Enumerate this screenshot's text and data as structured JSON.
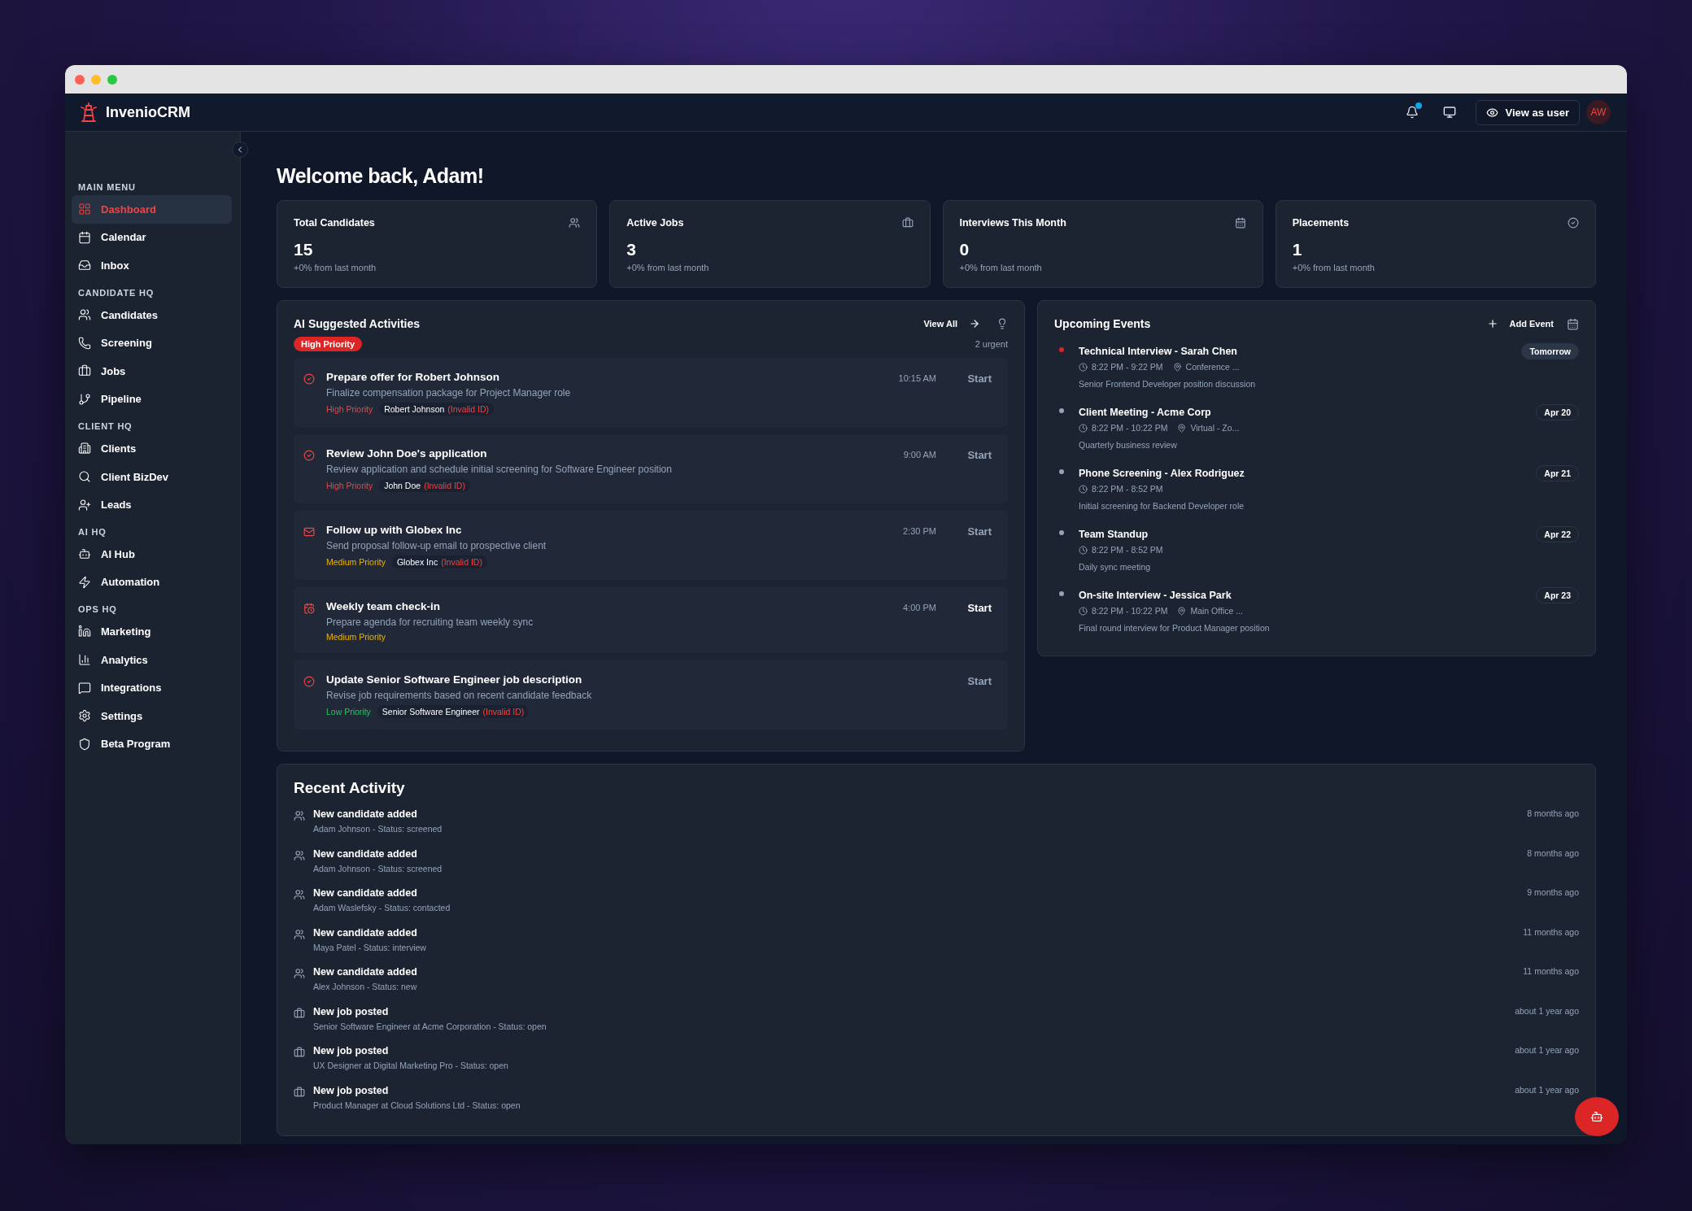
{
  "app": {
    "name": "InvenioCRM",
    "notification_unread": true,
    "view_as_user": "View as user",
    "avatar": "AW"
  },
  "sidebar": {
    "sections": [
      {
        "title": "MAIN MENU",
        "items": [
          {
            "label": "Dashboard",
            "selected": true
          },
          {
            "label": "Calendar",
            "selected": false
          },
          {
            "label": "Inbox",
            "selected": false
          }
        ]
      },
      {
        "title": "CANDIDATE HQ",
        "items": [
          {
            "label": "Candidates",
            "selected": false
          },
          {
            "label": "Screening",
            "selected": false
          },
          {
            "label": "Jobs",
            "selected": false
          },
          {
            "label": "Pipeline",
            "selected": false
          }
        ]
      },
      {
        "title": "CLIENT HQ",
        "items": [
          {
            "label": "Clients",
            "selected": false
          },
          {
            "label": "Client BizDev",
            "selected": false
          },
          {
            "label": "Leads",
            "selected": false
          }
        ]
      },
      {
        "title": "AI HQ",
        "items": [
          {
            "label": "AI Hub",
            "selected": false
          },
          {
            "label": "Automation",
            "selected": false
          }
        ]
      },
      {
        "title": "OPS HQ",
        "items": [
          {
            "label": "Marketing",
            "selected": false
          },
          {
            "label": "Analytics",
            "selected": false
          },
          {
            "label": "Integrations",
            "selected": false
          },
          {
            "label": "Settings",
            "selected": false
          },
          {
            "label": "Beta Program",
            "selected": false
          }
        ]
      }
    ]
  },
  "welcome": "Welcome back, Adam!",
  "stats": [
    {
      "title": "Total Candidates",
      "value": "15",
      "change": "+0% from last month"
    },
    {
      "title": "Active Jobs",
      "value": "3",
      "change": "+0% from last month"
    },
    {
      "title": "Interviews This Month",
      "value": "0",
      "change": "+0% from last month"
    },
    {
      "title": "Placements",
      "value": "1",
      "change": "+0% from last month"
    }
  ],
  "ai_activities": {
    "title": "AI Suggested Activities",
    "view_all": "View All",
    "badge": "High Priority",
    "urgent": "2 urgent",
    "items": [
      {
        "kind": "task",
        "title": "Prepare offer for Robert Johnson",
        "description": "Finalize compensation package for Project Manager role",
        "time": "10:15 AM",
        "action": "Start",
        "highlighted": false,
        "priority": {
          "label": "High Priority",
          "color": "#ef4444"
        },
        "entity": {
          "name": "Robert Johnson",
          "note": "(Invalid ID)"
        }
      },
      {
        "kind": "task",
        "title": "Review John Doe's application",
        "description": "Review application and schedule initial screening for Software Engineer position",
        "time": "9:00 AM",
        "action": "Start",
        "highlighted": false,
        "priority": {
          "label": "High Priority",
          "color": "#ef4444"
        },
        "entity": {
          "name": "John Doe",
          "note": "(Invalid ID)"
        }
      },
      {
        "kind": "email",
        "title": "Follow up with Globex Inc",
        "description": "Send proposal follow-up email to prospective client",
        "time": "2:30 PM",
        "action": "Start",
        "highlighted": false,
        "priority": {
          "label": "Medium Priority",
          "color": "#eab308"
        },
        "entity": {
          "name": "Globex Inc",
          "note": "(Invalid ID)"
        }
      },
      {
        "kind": "meeting",
        "title": "Weekly team check-in",
        "description": "Prepare agenda for recruiting team weekly sync",
        "time": "4:00 PM",
        "action": "Start",
        "highlighted": true,
        "priority": {
          "label": "Medium Priority",
          "color": "#eab308"
        }
      },
      {
        "kind": "task",
        "title": "Update Senior Software Engineer job description",
        "description": "Revise job requirements based on recent candidate feedback",
        "action": "Start",
        "highlighted": false,
        "priority": {
          "label": "Low Priority",
          "color": "#22c55e"
        },
        "entity": {
          "name": "Senior Software Engineer",
          "note": "(Invalid ID)"
        }
      }
    ]
  },
  "upcoming_events": {
    "title": "Upcoming Events",
    "add_event": "Add Event",
    "items": [
      {
        "title": "Technical Interview - Sarah Chen",
        "time": "8:22 PM - 9:22 PM",
        "location": "Conference ...",
        "description": "Senior Frontend Developer position discussion",
        "date": "Tomorrow",
        "highlighted": true,
        "color": "#dc2626"
      },
      {
        "title": "Client Meeting - Acme Corp",
        "time": "8:22 PM - 10:22 PM",
        "location": "Virtual - Zo...",
        "description": "Quarterly business review",
        "date": "Apr 20",
        "highlighted": false,
        "color": "#94a3b8"
      },
      {
        "title": "Phone Screening - Alex Rodriguez",
        "time": "8:22 PM - 8:52 PM",
        "description": "Initial screening for Backend Developer role",
        "date": "Apr 21",
        "highlighted": false,
        "color": "#94a3b8"
      },
      {
        "title": "Team Standup",
        "time": "8:22 PM - 8:52 PM",
        "description": "Daily sync meeting",
        "date": "Apr 22",
        "highlighted": false,
        "color": "#94a3b8"
      },
      {
        "title": "On-site Interview - Jessica Park",
        "time": "8:22 PM - 10:22 PM",
        "location": "Main Office ...",
        "description": "Final round interview for Product Manager position",
        "date": "Apr 23",
        "highlighted": false,
        "color": "#94a3b8"
      }
    ]
  },
  "recent_activity": {
    "title": "Recent Activity",
    "items": [
      {
        "kind": "candidate",
        "title": "New candidate added",
        "detail": "Adam Johnson - Status: screened",
        "time": "8 months ago"
      },
      {
        "kind": "candidate",
        "title": "New candidate added",
        "detail": "Adam Johnson - Status: screened",
        "time": "8 months ago"
      },
      {
        "kind": "candidate",
        "title": "New candidate added",
        "detail": "Adam Waslefsky - Status: contacted",
        "time": "9 months ago"
      },
      {
        "kind": "candidate",
        "title": "New candidate added",
        "detail": "Maya Patel - Status: interview",
        "time": "11 months ago"
      },
      {
        "kind": "candidate",
        "title": "New candidate added",
        "detail": "Alex Johnson - Status: new",
        "time": "11 months ago"
      },
      {
        "kind": "job",
        "title": "New job posted",
        "detail": "Senior Software Engineer at Acme Corporation - Status: open",
        "time": "about 1 year ago"
      },
      {
        "kind": "job",
        "title": "New job posted",
        "detail": "UX Designer at Digital Marketing Pro - Status: open",
        "time": "about 1 year ago"
      },
      {
        "kind": "job",
        "title": "New job posted",
        "detail": "Product Manager at Cloud Solutions Ltd - Status: open",
        "time": "about 1 year ago"
      }
    ]
  }
}
